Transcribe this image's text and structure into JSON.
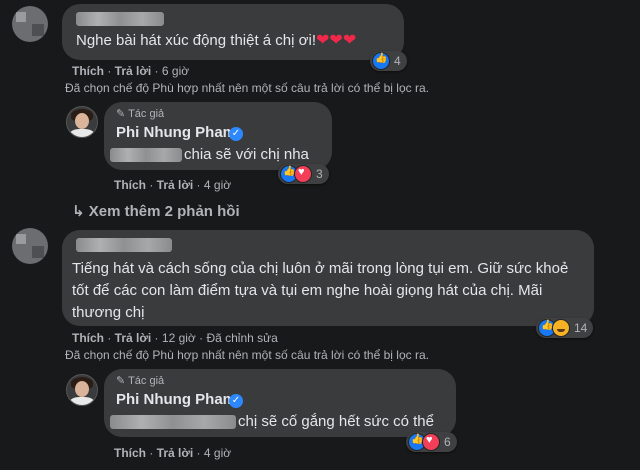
{
  "colors": {
    "background": "#18191a",
    "bubble": "#3a3b3c",
    "text": "#e4e6eb",
    "muted": "#b0b3b8",
    "like": "#1877f2",
    "heart": "#f33e58"
  },
  "comment1": {
    "text": "Nghe bài hát xúc động thiệt á chị ơi!",
    "emoji": "❤❤❤",
    "like_label": "Thích",
    "reply_label": "Trả lời",
    "time": "6 giờ",
    "reaction_count": "4",
    "filter_notice": "Đã chọn chế độ Phù hợp nhất nên một số câu trả lời có thể bị lọc ra."
  },
  "reply1": {
    "author_tag": "Tác giả",
    "author_name": "Phi Nhung Pham",
    "text": "chia sẽ với chị nha",
    "like_label": "Thích",
    "reply_label": "Trả lời",
    "time": "4 giờ",
    "reaction_count": "3"
  },
  "more_replies": {
    "label": "Xem thêm 2 phản hồi"
  },
  "comment2": {
    "text": "Tiếng hát và cách sống của chị luôn ở mãi trong lòng tụi em. Giữ sức khoẻ tốt để các con làm điểm tựa và tụi em nghe hoài giọng hát của chị. Mãi thương chị",
    "like_label": "Thích",
    "reply_label": "Trả lời",
    "time": "12 giờ",
    "edited": "Đã chỉnh sửa",
    "reaction_count": "14",
    "filter_notice": "Đã chọn chế độ Phù hợp nhất nên một số câu trả lời có thể bị lọc ra."
  },
  "reply2": {
    "author_tag": "Tác giả",
    "author_name": "Phi Nhung Pham",
    "text": "chị sẽ cố gắng hết sức có thể",
    "like_label": "Thích",
    "reply_label": "Trả lời",
    "time": "4 giờ",
    "reaction_count": "6"
  }
}
